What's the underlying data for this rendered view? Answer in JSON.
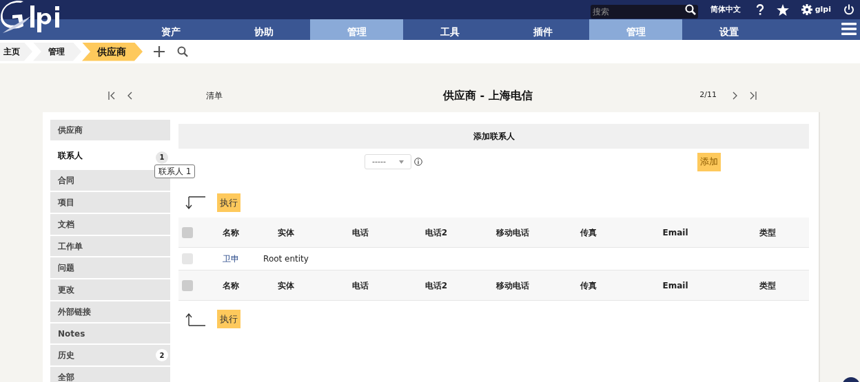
{
  "header": {
    "search": {
      "placeholder": "搜索"
    },
    "language": "简体中文",
    "user": "glpi"
  },
  "nav": [
    {
      "label": "资产",
      "selected": false
    },
    {
      "label": "协助",
      "selected": false
    },
    {
      "label": "管理",
      "selected": true
    },
    {
      "label": "工具",
      "selected": false
    },
    {
      "label": "插件",
      "selected": false
    },
    {
      "label": "管理",
      "selected": true
    },
    {
      "label": "设置",
      "selected": false
    }
  ],
  "breadcrumbs": [
    {
      "label": "主页",
      "selected": false
    },
    {
      "label": "管理",
      "selected": false
    },
    {
      "label": "供应商",
      "selected": true
    }
  ],
  "pager": {
    "list_label": "清单",
    "title": "供应商 - 上海电信",
    "position": "2/11"
  },
  "tabs": [
    {
      "label": "供应商",
      "selected": false
    },
    {
      "label": "联系人",
      "selected": true,
      "badge": "1"
    },
    {
      "label": "合同",
      "selected": false
    },
    {
      "label": "项目",
      "selected": false
    },
    {
      "label": "文档",
      "selected": false
    },
    {
      "label": "工作单",
      "selected": false
    },
    {
      "label": "问题",
      "selected": false
    },
    {
      "label": "更改",
      "selected": false
    },
    {
      "label": "外部链接",
      "selected": false
    },
    {
      "label": "Notes",
      "selected": false
    },
    {
      "label": "历史",
      "selected": false,
      "badge": "2"
    },
    {
      "label": "全部",
      "selected": false
    }
  ],
  "tooltip": "联系人 1",
  "add_panel": {
    "title": "添加联系人",
    "select_value": "-----",
    "button": "添加"
  },
  "top_action": "执行",
  "table": {
    "select_all_checked": false,
    "footer_select_all_checked": false,
    "columns": [
      "名称",
      "实体",
      "电话",
      "电话2",
      "移动电话",
      "传真",
      "Email",
      "类型"
    ],
    "rows": [
      {
        "checked": false,
        "name": "卫申",
        "entity": "Root entity"
      }
    ],
    "footer_columns": [
      "名称",
      "实体",
      "电话",
      "电话2",
      "移动电话",
      "传真",
      "Email",
      "类型"
    ]
  },
  "bottom_action": "执行"
}
